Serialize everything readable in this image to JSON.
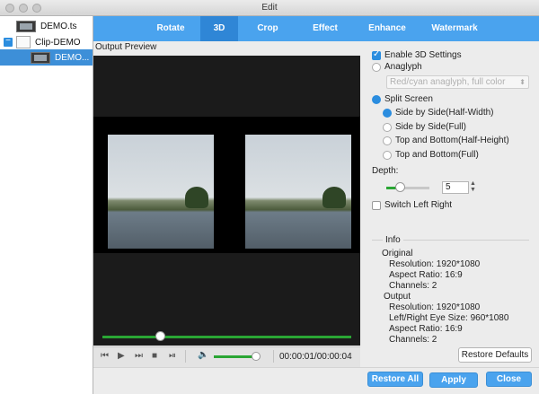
{
  "window": {
    "title": "Edit"
  },
  "tree": {
    "items": [
      {
        "label": "DEMO.ts"
      },
      {
        "label": "Clip-DEMO"
      },
      {
        "label": "DEMO..."
      }
    ]
  },
  "tabs": [
    {
      "label": "Rotate"
    },
    {
      "label": "3D"
    },
    {
      "label": "Crop"
    },
    {
      "label": "Effect"
    },
    {
      "label": "Enhance"
    },
    {
      "label": "Watermark"
    }
  ],
  "preview": {
    "label": "Output Preview",
    "seek_progress": 0.23
  },
  "player": {
    "time": "00:00:01/00:00:04",
    "volume": 0.9
  },
  "settings": {
    "enable_3d": "Enable 3D Settings",
    "anaglyph": "Anaglyph",
    "anaglyph_select": "Red/cyan anaglyph, full color",
    "split_screen": "Split Screen",
    "options": [
      "Side by Side(Half-Width)",
      "Side by Side(Full)",
      "Top and Bottom(Half-Height)",
      "Top and Bottom(Full)"
    ],
    "depth_label": "Depth:",
    "depth_value": "5",
    "switch_lr": "Switch Left Right"
  },
  "info": {
    "title": "Info",
    "original_title": "Original",
    "original": [
      "Resolution: 1920*1080",
      "Aspect Ratio: 16:9",
      "Channels: 2"
    ],
    "output_title": "Output",
    "output": [
      "Resolution: 1920*1080",
      "Left/Right Eye Size: 960*1080",
      "Aspect Ratio: 16:9",
      "Channels: 2"
    ]
  },
  "buttons": {
    "restore_defaults": "Restore Defaults",
    "restore_all": "Restore All",
    "apply": "Apply",
    "close": "Close"
  },
  "colors": {
    "accent": "#4aa3ee",
    "active_tab": "#2f86d6",
    "progress": "#2aa634"
  }
}
